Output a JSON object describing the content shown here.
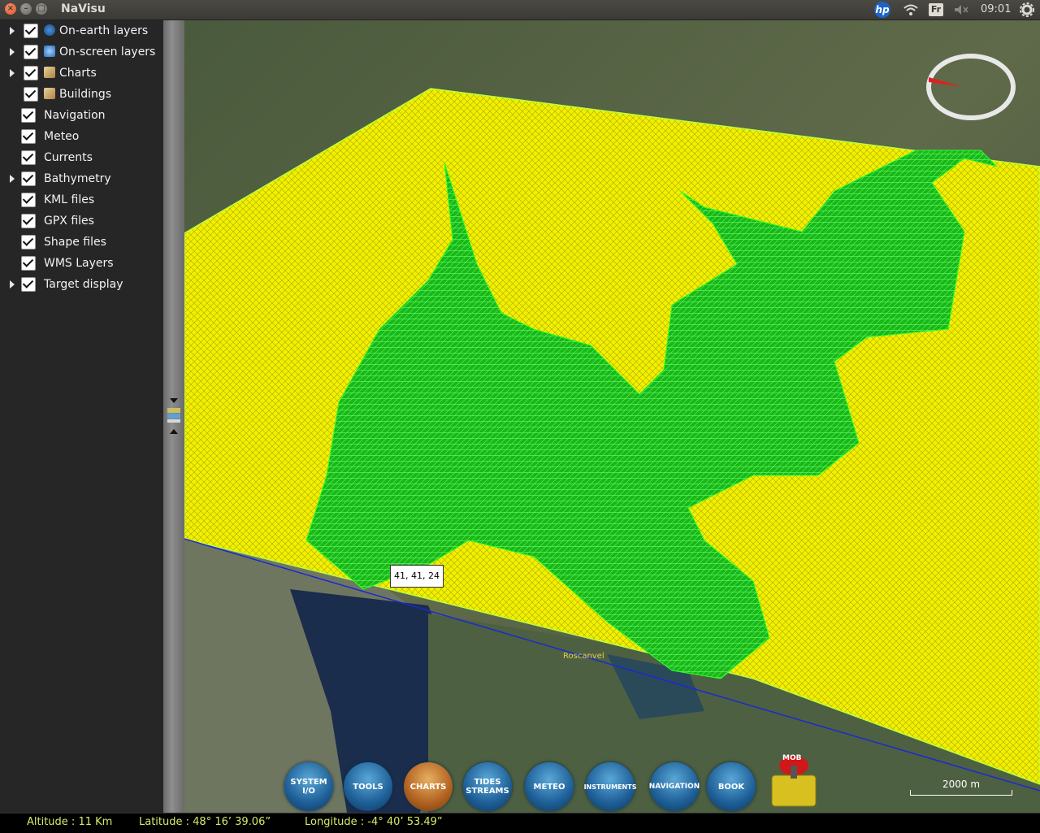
{
  "window": {
    "title": "NaVisu"
  },
  "tray": {
    "keyboard": "Fr",
    "clock": "09:01",
    "hp_logo": "hp"
  },
  "layers": [
    {
      "label": "On-earth layers",
      "expandable": true,
      "checked": true,
      "icon": "globe-icon"
    },
    {
      "label": "On-screen layers",
      "expandable": true,
      "checked": true,
      "icon": "screen-globe-icon"
    },
    {
      "label": "Charts",
      "expandable": true,
      "checked": true,
      "icon": "chart-icon"
    },
    {
      "label": "Buildings",
      "expandable": false,
      "checked": true,
      "icon": "buildings-icon"
    },
    {
      "label": "Navigation",
      "expandable": false,
      "checked": true
    },
    {
      "label": "Meteo",
      "expandable": false,
      "checked": true
    },
    {
      "label": "Currents",
      "expandable": false,
      "checked": true
    },
    {
      "label": "Bathymetry",
      "expandable": true,
      "checked": true
    },
    {
      "label": "KML files",
      "expandable": false,
      "checked": true
    },
    {
      "label": "GPX files",
      "expandable": false,
      "checked": true
    },
    {
      "label": "Shape files",
      "expandable": false,
      "checked": true
    },
    {
      "label": "WMS Layers",
      "expandable": false,
      "checked": true
    },
    {
      "label": "Target display",
      "expandable": true,
      "checked": true
    }
  ],
  "map": {
    "tooltip": "41, 41, 24",
    "place_label": "Roscanvel",
    "scale_label": "2000 m"
  },
  "toolbar": [
    {
      "label": "SYSTEM I/O"
    },
    {
      "label": "TOOLS"
    },
    {
      "label": "CHARTS"
    },
    {
      "label": "TIDES STREAMS"
    },
    {
      "label": "METEO"
    },
    {
      "label": "INSTRUMENTS"
    },
    {
      "label": "NAVIGATION"
    },
    {
      "label": "BOOK"
    }
  ],
  "mob_label": "MOB",
  "status": {
    "altitude": "Altitude : 11 Km",
    "latitude": "Latitude :   48° 16’ 39.06”",
    "longitude": "Longitude :  -4° 40’ 53.49”"
  },
  "colors": {
    "mesh_yellow": "#f2f000",
    "mesh_green": "#22cc22",
    "sidebar": "#262626"
  }
}
